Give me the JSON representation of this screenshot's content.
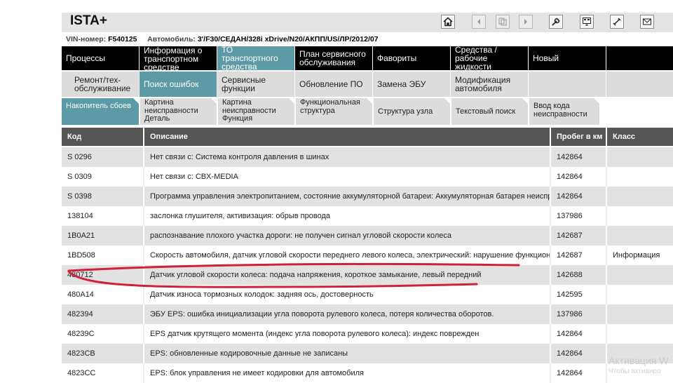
{
  "app": {
    "title": "ISTA+"
  },
  "vehicle": {
    "vin_label": "VIN-номер:",
    "vin": "F540125",
    "car_label": "Автомобиль:",
    "car": "3'/F30/СЕДАН/328i xDrive/N20/АКПП/US/ЛР/2012/07"
  },
  "menu_main": [
    {
      "label": "Процессы"
    },
    {
      "label": "Информация о транспортном средстве"
    },
    {
      "label": "ТО транспортного средства",
      "active": true
    },
    {
      "label": "План сервисного обслуживания"
    },
    {
      "label": "Фавориты"
    },
    {
      "label": "Средства / рабочие жидкости"
    },
    {
      "label": "Новый"
    },
    {
      "label": ""
    }
  ],
  "menu_sub": [
    {
      "label": "Ремонт/тех-обслуживание"
    },
    {
      "label": "Поиск ошибок",
      "active": true
    },
    {
      "label": "Сервисные функции"
    },
    {
      "label": "Обновление ПО"
    },
    {
      "label": "Замена ЭБУ"
    },
    {
      "label": "Модификация автомобиля"
    },
    {
      "label": ""
    },
    {
      "label": ""
    }
  ],
  "tabs": [
    {
      "label": "Накопитель сбоев",
      "active": true
    },
    {
      "label": "Картина неисправности Деталь"
    },
    {
      "label": "Картина неисправности Функция"
    },
    {
      "label": "Функциональная структура"
    },
    {
      "label": "Структура узла"
    },
    {
      "label": "Текстовый поиск"
    },
    {
      "label": "Ввод кода неисправности"
    }
  ],
  "table": {
    "headers": [
      "Код",
      "Описание",
      "Пробег в км",
      "Класс"
    ],
    "rows": [
      {
        "code": "S 0296",
        "desc": "Нет связи с: Система контроля давления в шинах",
        "km": "142864",
        "cls": ""
      },
      {
        "code": "S 0309",
        "desc": "Нет связи с: CBX-MEDIA",
        "km": "142864",
        "cls": ""
      },
      {
        "code": "S 0398",
        "desc": "Программа управления электропитанием, состояние аккумуляторной батареи: Аккумуляторная батарея неисправ",
        "km": "142864",
        "cls": ""
      },
      {
        "code": "138104",
        "desc": "заслонка глушителя, активизация: обрыв провода",
        "km": "137986",
        "cls": ""
      },
      {
        "code": "1B0A21",
        "desc": "распознавание плохого участка дороги: не получен сигнал угловой скорости колеса",
        "km": "142687",
        "cls": ""
      },
      {
        "code": "1BD508",
        "desc": "Скорость автомобиля, датчик угловой скорости переднего левого колеса, электрический: нарушение функциони",
        "km": "142687",
        "cls": "Информация"
      },
      {
        "code": "480712",
        "desc": "Датчик угловой скорости колеса: подача напряжения, короткое замыкание, левый передний",
        "km": "142688",
        "cls": ""
      },
      {
        "code": "480A14",
        "desc": "Датчик износа тормозных колодок: задняя ось, достоверность",
        "km": "142595",
        "cls": ""
      },
      {
        "code": "482394",
        "desc": "ЭБУ EPS: ошибка инициализации угла поворота рулевого колеса, потеря количества оборотов.",
        "km": "137986",
        "cls": ""
      },
      {
        "code": "48239C",
        "desc": "EPS датчик крутящего момента (индекс угла поворота рулевого колеса): индекс поврежден",
        "km": "142864",
        "cls": ""
      },
      {
        "code": "4823CB",
        "desc": "EPS: обновленные кодировочные данные не записаны",
        "km": "142864",
        "cls": ""
      },
      {
        "code": "4823CC",
        "desc": "EPS: блок управления не имеет кодировки для автомобиля",
        "km": "142864",
        "cls": ""
      }
    ]
  },
  "toolbar_icons": [
    "home-icon",
    "back-icon",
    "copy-icon",
    "forward-icon",
    "wrench-icon",
    "display-icon",
    "settings-icon",
    "mail-icon"
  ],
  "colors": {
    "accent": "#5b9aa6",
    "menu_bg": "#000000",
    "header_bg": "#555555",
    "annotation": "#d0213a"
  },
  "watermark": {
    "line1": "Активация W",
    "line2": "Чтобы активиро"
  }
}
